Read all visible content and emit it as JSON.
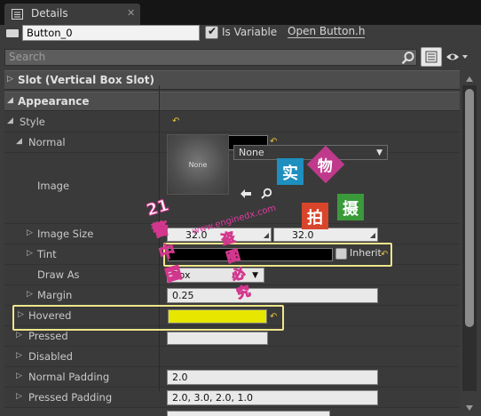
{
  "tab": {
    "title": "Details",
    "close": "✕"
  },
  "header": {
    "name_value": "Button_0",
    "is_variable_checked": true,
    "is_variable_label": "Is Variable",
    "open_button_label": "Open Button.h"
  },
  "search": {
    "placeholder": "Search"
  },
  "sections": {
    "slot": "Slot (Vertical Box Slot)",
    "appearance": "Appearance"
  },
  "rows": {
    "style": "Style",
    "normal": "Normal",
    "image": "Image",
    "image_size": "Image Size",
    "tint": "Tint",
    "draw_as": "Draw As",
    "margin": "Margin",
    "hovered": "Hovered",
    "pressed": "Pressed",
    "disabled": "Disabled",
    "normal_padding": "Normal Padding",
    "pressed_padding": "Pressed Padding"
  },
  "values": {
    "image_thumb": "None",
    "image_asset": "None",
    "image_size_x": "32.0",
    "image_size_y": "32.0",
    "inherit_label": "Inherit",
    "draw_as": "Box",
    "margin": "0.25",
    "normal_padding": "2.0",
    "pressed_padding": "2.0, 3.0, 2.0, 1.0"
  },
  "colors": {
    "normal_swatch": "#000000",
    "tint_swatch": "#000000",
    "hovered_swatch": "#e6e600",
    "pressed_swatch": "#e8e8e8",
    "highlight_border": "#f0e68c",
    "reset_arrow": "#e8c23c"
  },
  "watermark": {
    "site": "www.enginedx.com",
    "line1": "21警中国",
    "line2": "盗图必究",
    "tiles": [
      "实",
      "物",
      "拍",
      "摄"
    ]
  }
}
